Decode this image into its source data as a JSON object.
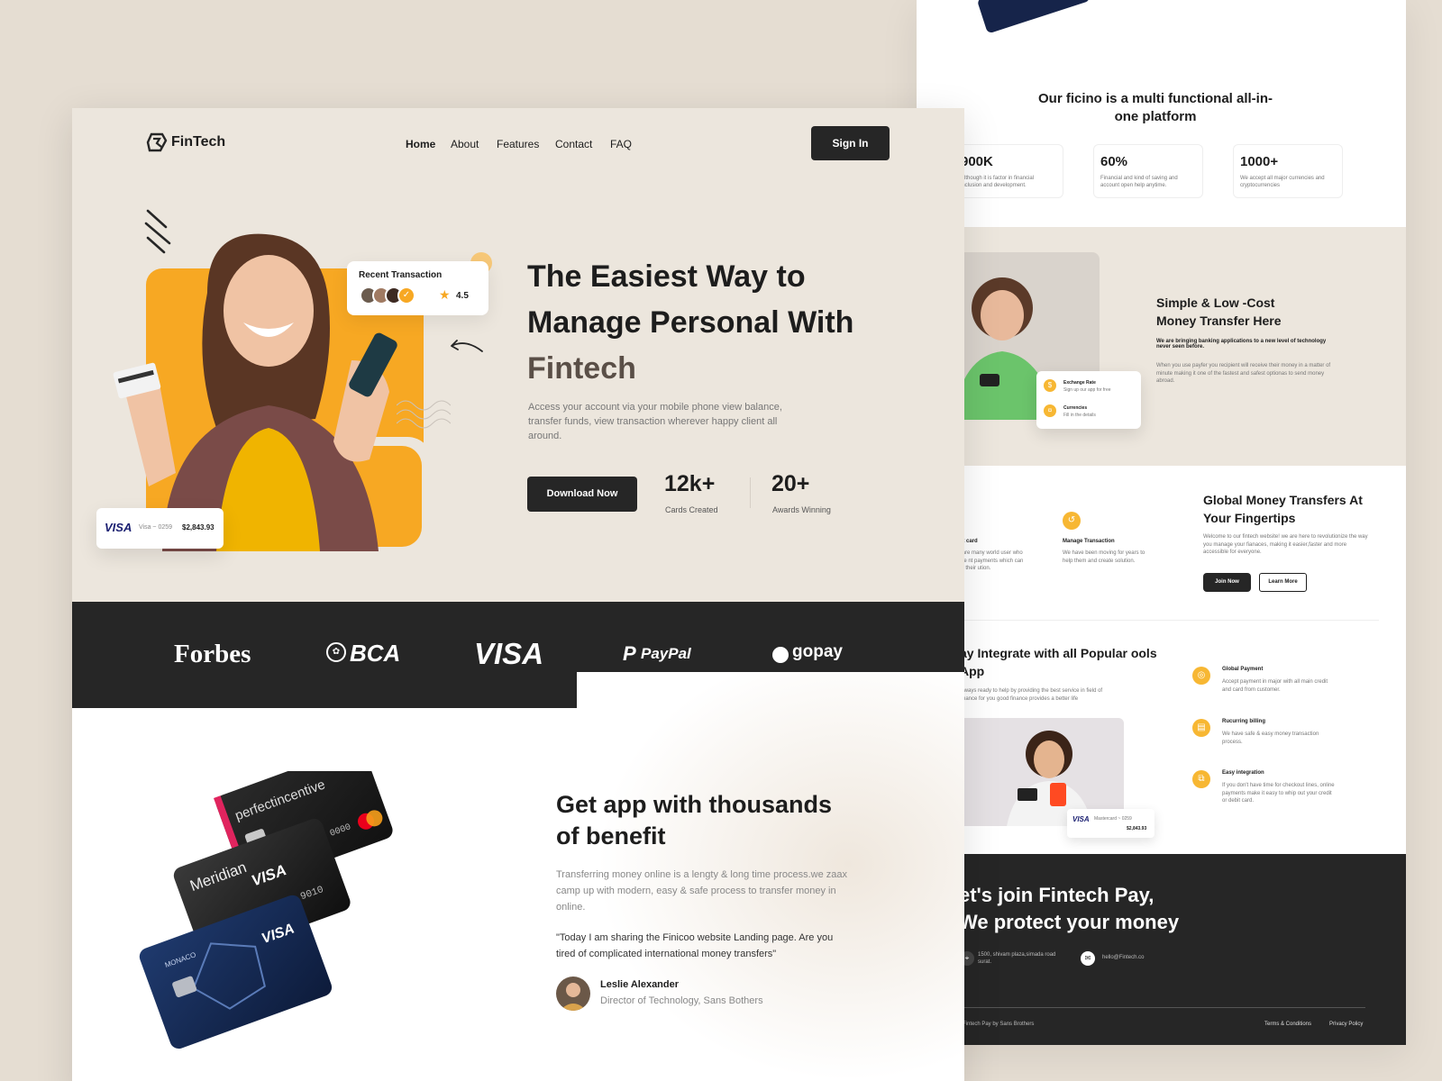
{
  "back": {
    "platform_title": "Our ficino is a multi functional all-in-one platform",
    "stats": [
      {
        "value": "900K",
        "desc": "Although it is factor in financial inclusion and development."
      },
      {
        "value": "60%",
        "desc": "Financial and kind of saving and account open help anytime."
      },
      {
        "value": "1000+",
        "desc": "We accept all major currencies and cryptocurrencies"
      }
    ],
    "transfer": {
      "title": "Simple & Low -Cost Money Transfer Here",
      "bold": "We are bringing banking applications to a new level of technology never seen before.",
      "body": "When you use payfer you recipient will receive their money in a matter of minute making it one of the fastest and safest optionas to send money abroad.",
      "popup": [
        {
          "title": "Exchange Rate",
          "desc": "Sign up our app for free"
        },
        {
          "title": "Currencies",
          "desc": "Fill in the details"
        }
      ]
    },
    "global": {
      "title": "Global Money Transfers At Your Fingertips",
      "body": "Welcome to our fintech website! we are here to revolutionize the way you manage your fianaces, making it easier,faster and more accessible for everyone.",
      "join": "Join Now",
      "learn": "Learn More",
      "feature1_title": "bit card",
      "feature1_desc": "y are many world user who use nt payments which can be their ution.",
      "feature2_title": "Manage Transaction",
      "feature2_desc": "We have been moving for years to help them and create solution."
    },
    "integrate": {
      "title": "ay Integrate with all Popular ools App",
      "body": "always ready to help by providing the best service in field of finance for you good finance provides a better life",
      "items": [
        {
          "title": "Global Payment",
          "desc": "Accept payment in major with all main credit and card from customer."
        },
        {
          "title": "Rucurring billing",
          "desc": "We have safe & easy money transaction process."
        },
        {
          "title": "Easy integration",
          "desc": "If you don't have time for checkout lines, online payments make it easy to whip out your credit or debit card."
        }
      ],
      "card_brand": "VISA",
      "card_label": "Mastercard ~ 0259",
      "card_amount": "$2,843.93"
    },
    "footer": {
      "title_line1": "et's join Fintech Pay,",
      "title_line2": "We protect your money",
      "address": "1500, shivam plaza,simada road surat.",
      "email": "hello@Fintech.co",
      "copyright": "Fintech Pay by Sans Brothers",
      "terms": "Terms & Conditions",
      "privacy": "Privacy Policy"
    }
  },
  "front": {
    "logo": "FinTech",
    "nav": [
      "Home",
      "About",
      "Features",
      "Contact",
      "FAQ"
    ],
    "signin": "Sign In",
    "hero": {
      "title_l1": "The Easiest Way to",
      "title_l2": "Manage Personal With",
      "title_l3": "Fintech",
      "desc": "Access your account via your mobile phone view balance, transfer funds, view transaction wherever happy client all around.",
      "cta": "Download Now",
      "stat1_value": "12k+",
      "stat1_label": "Cards Created",
      "stat2_value": "20+",
      "stat2_label": "Awards Winning",
      "recent_label": "Recent Transaction",
      "rating": "4.5",
      "card_brand": "VISA",
      "card_label": "Visa ~ 0259",
      "card_amount": "$2,843.93"
    },
    "logos": [
      "Forbes",
      "BCA",
      "VISA",
      "PayPal",
      "gopay"
    ],
    "benefit": {
      "title_l1": "Get app with thousands",
      "title_l2": "of benefit",
      "desc": "Transferring money online is a lengty & long time process.we zaax camp up with modern, easy & safe process to transfer money in online.",
      "quote": "\"Today I am sharing the Finicoo website Landing page. Are you tired of complicated international money transfers\"",
      "author": "Leslie Alexander",
      "role": "Director of Technology, Sans Bothers"
    },
    "cards": {
      "c1_brand": "perfectincentive",
      "c1_number": "5145 2301 0000 0000",
      "c2_brand": "Meridian",
      "c2_visa": "VISA",
      "c2_number": "78 9010",
      "c3_brand": "MONACO",
      "c3_visa": "VISA"
    }
  },
  "colors": {
    "accent": "#f7a823",
    "dark": "#262626",
    "beige": "#ece6dd",
    "bg": "#e5ddd2"
  }
}
